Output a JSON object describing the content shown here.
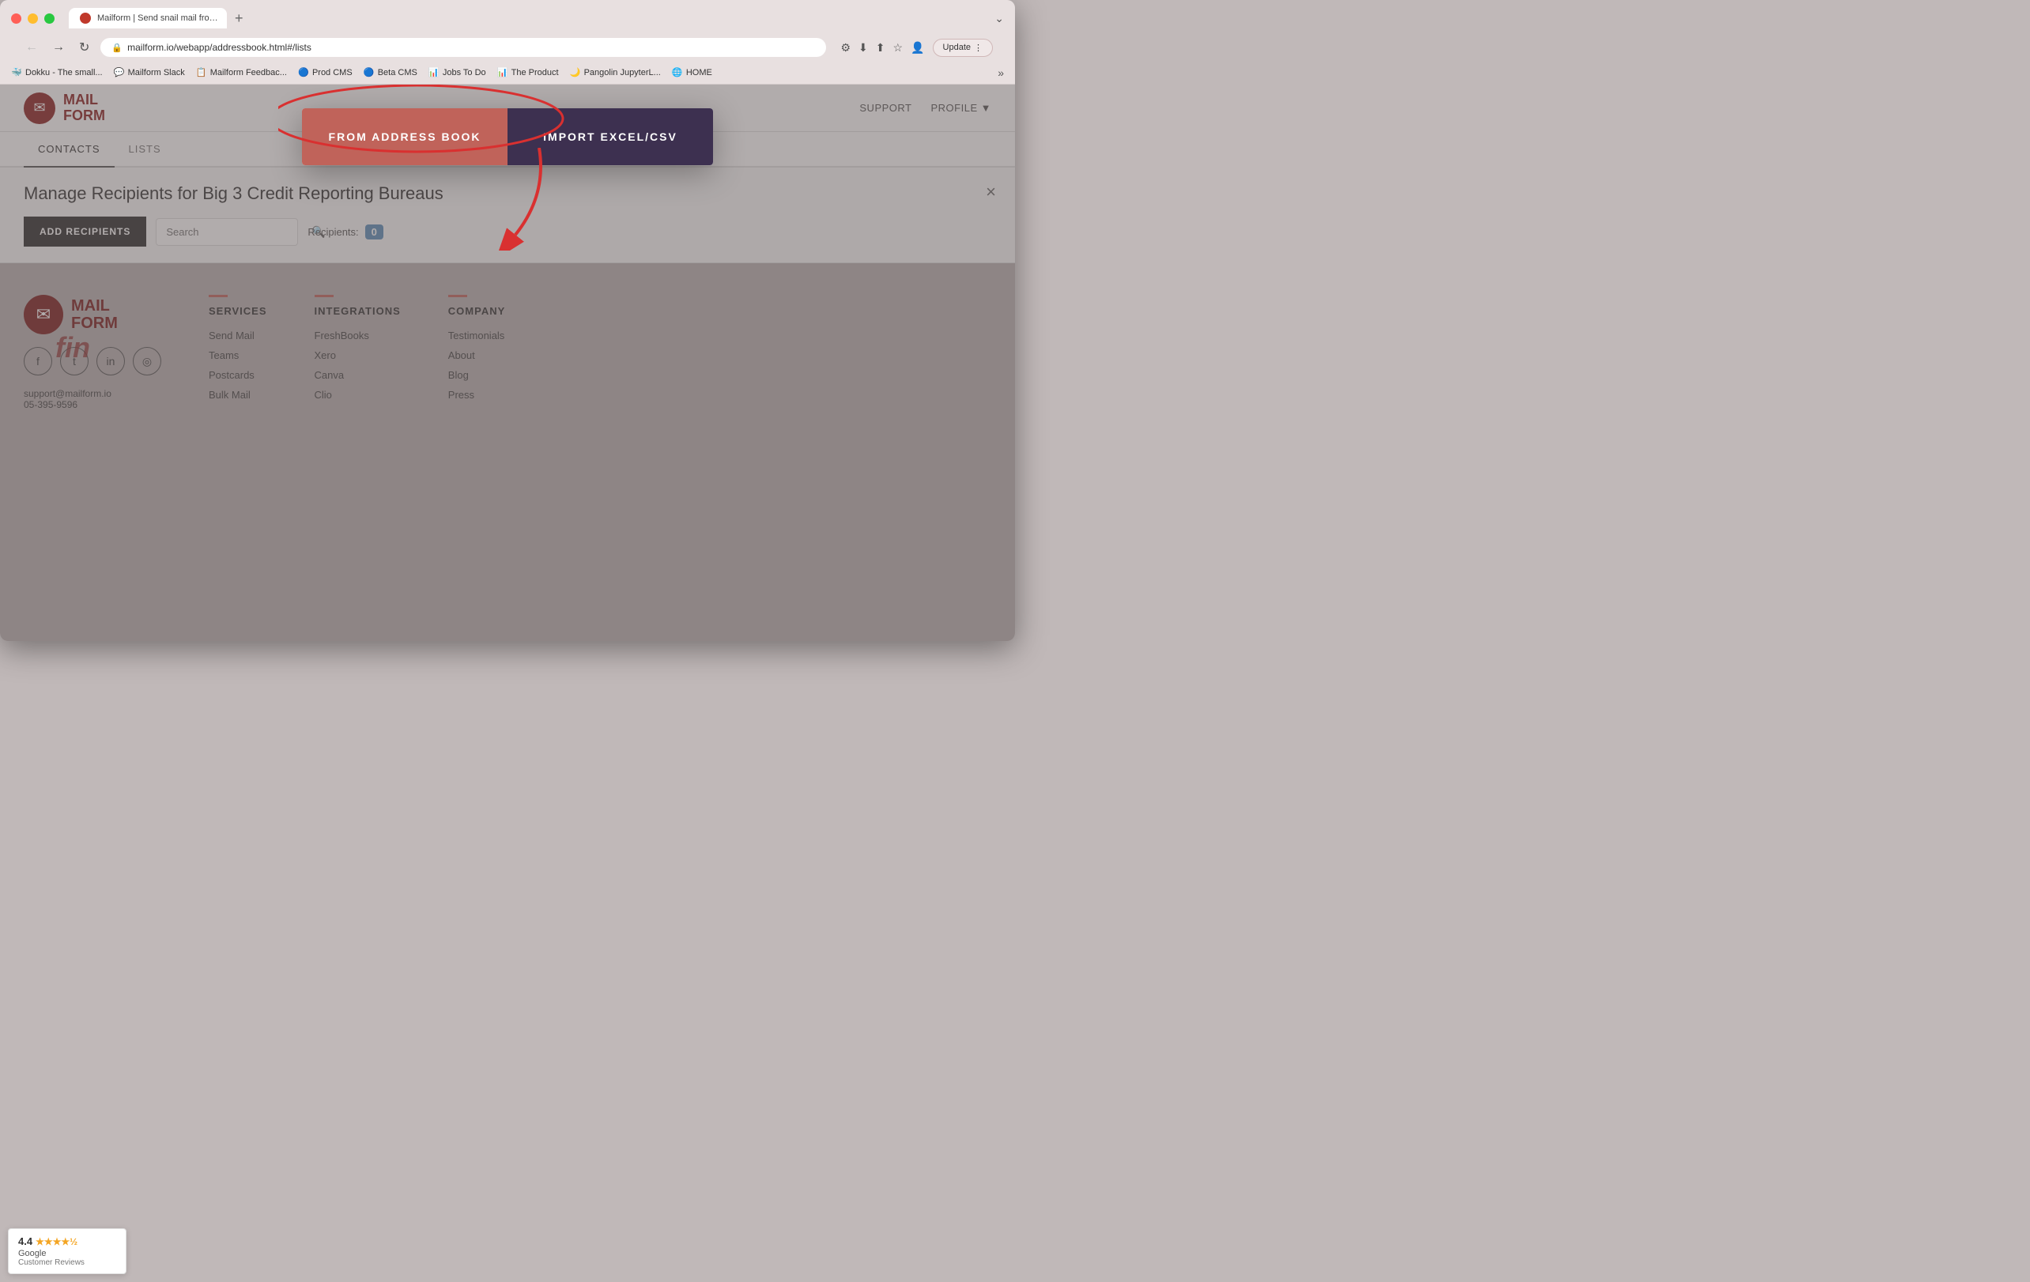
{
  "browser": {
    "tab_title": "Mailform | Send snail mail fro…",
    "tab_close": "×",
    "new_tab": "+",
    "url": "mailform.io/webapp/addressbook.html#/lists",
    "chevron": "›",
    "back": "←",
    "forward": "→",
    "refresh": "↻",
    "update_label": "Update",
    "bookmarks": [
      {
        "label": "Dokku - The small...",
        "icon": "🐳"
      },
      {
        "label": "Mailform Slack",
        "icon": "💬"
      },
      {
        "label": "Mailform Feedbac...",
        "icon": "📋"
      },
      {
        "label": "Prod CMS",
        "icon": "🔵"
      },
      {
        "label": "Beta CMS",
        "icon": "🔵"
      },
      {
        "label": "Jobs To Do",
        "icon": "📊"
      },
      {
        "label": "The Product",
        "icon": "📊"
      },
      {
        "label": "Pangolin JupyterL...",
        "icon": "🌙"
      },
      {
        "label": "HOME",
        "icon": "🌐"
      }
    ],
    "more": "»"
  },
  "app": {
    "logo_text_line1": "MAIL",
    "logo_text_line2": "FORM",
    "nav": {
      "support": "SUPPORT",
      "profile": "PROFILE"
    },
    "tabs": {
      "contacts": "CONTACTS",
      "lists": "LISTS"
    }
  },
  "modal": {
    "from_address_book": "FROM ADDRESS BOOK",
    "import_excel_csv": "IMPORT EXCEL/CSV"
  },
  "manage": {
    "title": "Manage Recipients for Big 3 Credit Reporting Bureaus",
    "add_recipients": "ADD RECIPIENTS",
    "search_placeholder": "Search",
    "recipients_label": "Recipients:",
    "recipients_count": "0",
    "close": "×"
  },
  "footer": {
    "logo_text_line1": "MAIL",
    "logo_text_line2": "FORM",
    "social": {
      "facebook": "f",
      "twitter": "t",
      "linkedin": "in",
      "instagram": "◎"
    },
    "contact_email": "support@mailform.io",
    "contact_phone": "05-395-9596",
    "services": {
      "title": "SERVICES",
      "links": [
        "Send Mail",
        "Teams",
        "Postcards",
        "Bulk Mail"
      ]
    },
    "integrations": {
      "title": "INTEGRATIONS",
      "links": [
        "FreshBooks",
        "Xero",
        "Canva",
        "Clio"
      ]
    },
    "company": {
      "title": "COMPANY",
      "links": [
        "Testimonials",
        "About",
        "Blog",
        "Press"
      ]
    }
  },
  "google_review": {
    "rating": "4.4",
    "stars": "★★★★½",
    "brand": "Google",
    "label": "Customer Reviews"
  },
  "fin_label": "fin"
}
